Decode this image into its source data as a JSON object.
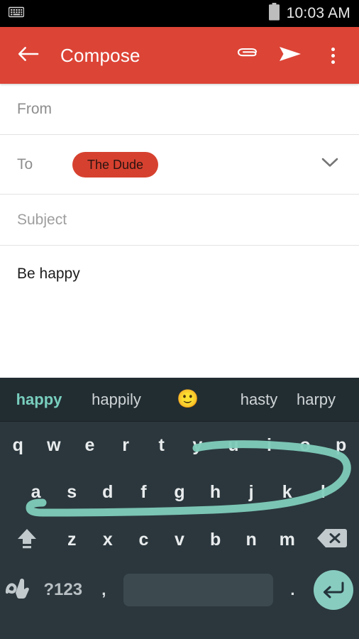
{
  "status_bar": {
    "keyboard_icon": "keyboard-icon",
    "battery_icon": "battery-icon",
    "time": "10:03 AM"
  },
  "app_bar": {
    "back_icon": "back-arrow-icon",
    "title": "Compose",
    "attach_icon": "paperclip-icon",
    "send_icon": "send-icon",
    "overflow_icon": "overflow-menu-icon",
    "background_color": "#dc4436"
  },
  "compose": {
    "from": {
      "label": "From",
      "value": ""
    },
    "to": {
      "label": "To",
      "chips": [
        {
          "name": "The Dude",
          "color": "#d6412f"
        }
      ],
      "expand_icon": "chevron-down-icon"
    },
    "subject": {
      "placeholder": "Subject",
      "value": ""
    },
    "body": {
      "value": "Be happy"
    }
  },
  "keyboard": {
    "background_color": "#2b373d",
    "accent_color": "#88ccc0",
    "suggestions": [
      {
        "text": "happy",
        "active": true
      },
      {
        "text": "happily",
        "active": false
      },
      {
        "text": "🙂",
        "active": false,
        "is_emoji": true
      },
      {
        "text": "hasty",
        "active": false
      },
      {
        "text": "harpy",
        "active": false
      }
    ],
    "row1": [
      "q",
      "w",
      "e",
      "r",
      "t",
      "y",
      "u",
      "i",
      "o",
      "p"
    ],
    "row2": [
      "a",
      "s",
      "d",
      "f",
      "g",
      "h",
      "j",
      "k",
      "l"
    ],
    "row3_keys": [
      "z",
      "x",
      "c",
      "v",
      "b",
      "n",
      "m"
    ],
    "shift_icon": "shift-icon",
    "backspace_icon": "backspace-icon",
    "row4": {
      "gesture_icon": "gesture-typing-icon",
      "symbols_label": "?123",
      "comma_label": ",",
      "space_label": "",
      "period_label": ".",
      "enter_icon": "enter-icon"
    },
    "swipe_trail": {
      "color": "#7fccbb",
      "description": "gesture-swipe-trail"
    }
  }
}
